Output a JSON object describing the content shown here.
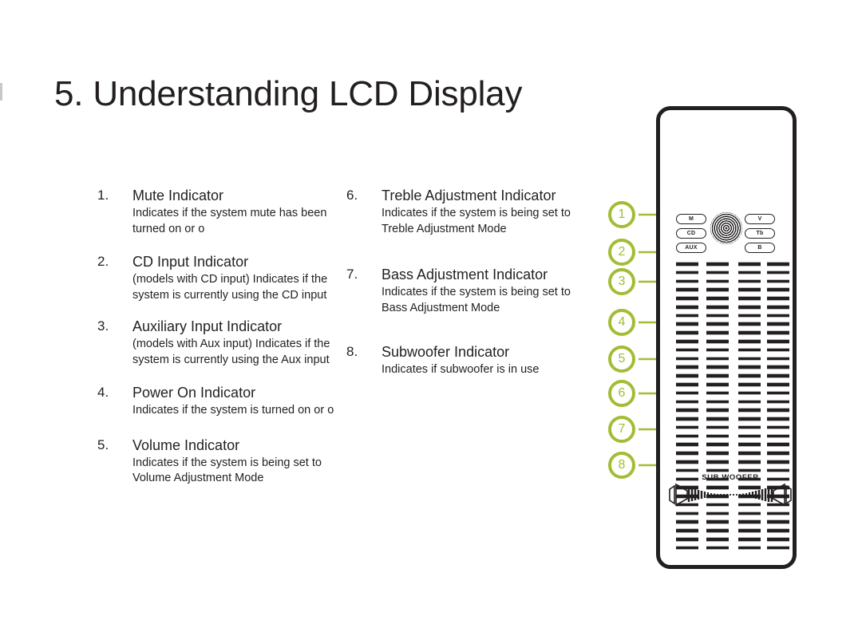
{
  "page": {
    "title": "5. Understanding LCD Display"
  },
  "accent_color": "#a2bd35",
  "ink_color": "#231f20",
  "items_left": [
    {
      "number": "1.",
      "title": "Mute Indicator",
      "description": "Indicates if the system mute has been turned on or o"
    },
    {
      "number": "2.",
      "title": "CD Input Indicator",
      "description": "(models with CD input)\nIndicates if the system is currently using the CD input"
    },
    {
      "number": "3.",
      "title": "Auxiliary Input Indicator",
      "description": "(models with Aux input)\nIndicates if the system is currently using the Aux input"
    },
    {
      "number": "4.",
      "title": "Power On Indicator",
      "description": "Indicates if the system is turned on or o"
    },
    {
      "number": "5.",
      "title": "Volume Indicator",
      "description": "Indicates if the system is being set to Volume Adjustment Mode"
    }
  ],
  "items_right": [
    {
      "number": "6.",
      "title": "Treble Adjustment Indicator",
      "description": "Indicates if the system is being set to Treble Adjustment Mode"
    },
    {
      "number": "7.",
      "title": "Bass Adjustment Indicator",
      "description": "Indicates if the system is being set to Bass Adjustment Mode"
    },
    {
      "number": "8.",
      "title": "Subwoofer Indicator",
      "description": "Indicates if subwoofer is in use"
    }
  ],
  "callouts": [
    {
      "label": "1"
    },
    {
      "label": "2"
    },
    {
      "label": "3"
    },
    {
      "label": "4"
    },
    {
      "label": "5"
    },
    {
      "label": "6"
    },
    {
      "label": "7"
    },
    {
      "label": "8"
    }
  ],
  "lcd_panel": {
    "badges_left": [
      {
        "label": "M"
      },
      {
        "label": "CD"
      },
      {
        "label": "AUX"
      }
    ],
    "badges_right": [
      {
        "label": "V"
      },
      {
        "label": "Tb"
      },
      {
        "label": "B"
      }
    ],
    "dial_icon": "concentric-rings-icon",
    "subwoofer_label": "SUB WOOFER",
    "bar_columns": 4,
    "bar_segments_per_column": 34
  }
}
